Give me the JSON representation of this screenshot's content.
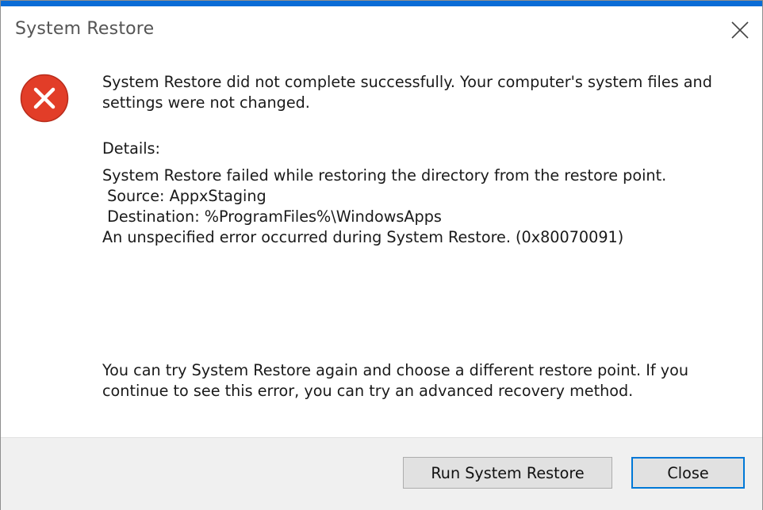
{
  "window": {
    "title": "System Restore",
    "accent_color": "#0a6cd6",
    "close_icon": "close-x-icon"
  },
  "icon": {
    "name": "error-icon",
    "color": "#e23d28"
  },
  "message": {
    "line1": "System Restore did not complete successfully. Your computer's system files and",
    "line2": "settings were not changed."
  },
  "details": {
    "label": "Details:",
    "lines": [
      "System Restore failed while restoring the directory from the restore point.",
      " Source: AppxStaging",
      " Destination: %ProgramFiles%\\WindowsApps",
      "An unspecified error occurred during System Restore. (0x80070091)"
    ]
  },
  "suggestion": {
    "line1": "You can try System Restore again and choose a different restore point. If you",
    "line2": "continue to see this error, you can try an advanced recovery method."
  },
  "buttons": {
    "run_label": "Run System Restore",
    "close_label": "Close",
    "default_border_color": "#0078d7"
  }
}
